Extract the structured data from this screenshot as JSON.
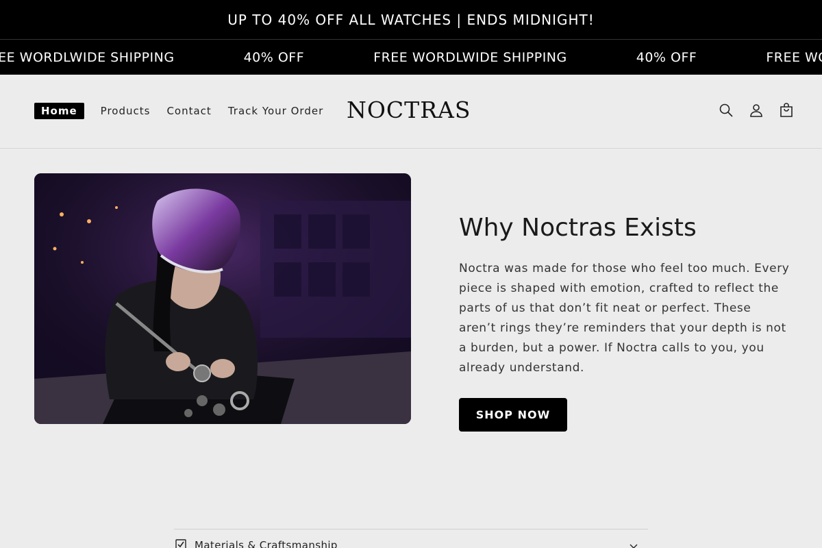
{
  "announcement": {
    "text": "UP TO 40% OFF ALL WATCHES | ENDS MIDNIGHT!"
  },
  "marquee": {
    "items": [
      "FREE WORDLWIDE SHIPPING",
      "40% OFF",
      "FREE WORDLWIDE SHIPPING",
      "40% OFF",
      "FREE WORDLWIDE SHIPPING"
    ]
  },
  "header": {
    "nav": [
      "Home",
      "Products",
      "Contact",
      "Track Your Order"
    ],
    "logo": "NOCTRAS",
    "icons": [
      "search-icon",
      "account-icon",
      "cart-icon"
    ]
  },
  "hero": {
    "title": "Why Noctras Exists",
    "body": "Noctra was made for those who feel too much. Every piece is shaped with emotion, crafted to reflect the parts of us that don’t fit neat or perfect. These aren’t rings they’re reminders that your depth is not a burden, but a power. If Noctra calls to you, you already understand.",
    "button": "SHOP NOW"
  },
  "accordion": {
    "label": "Materials & Craftsmanship"
  },
  "colors": {
    "background": "#ececec",
    "bar": "#000000",
    "accent_purple": "#4a2a6a"
  }
}
